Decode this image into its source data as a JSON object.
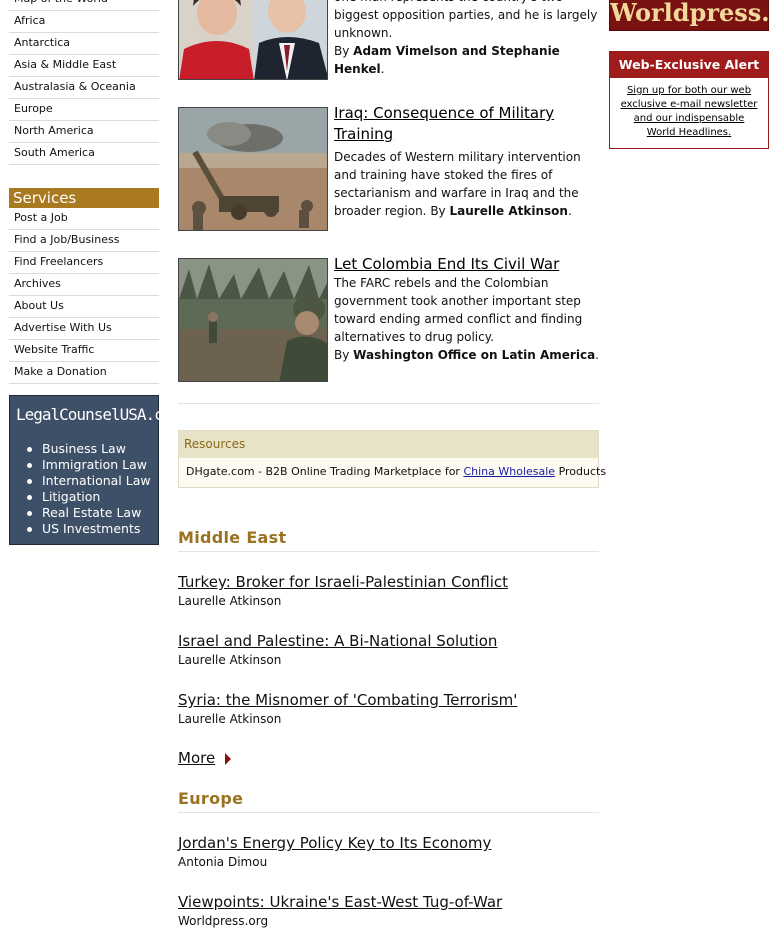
{
  "nav": {
    "regions": [
      "Map of the World",
      "Africa",
      "Antarctica",
      "Asia & Middle East",
      "Australasia & Oceania",
      "Europe",
      "North America",
      "South America"
    ]
  },
  "services": {
    "title": "Services",
    "items": [
      "Post a Job",
      "Find a Job/Business",
      "Find Freelancers",
      "Archives",
      "About Us",
      "Advertise With Us",
      "Website Traffic",
      "Make a Donation"
    ]
  },
  "legal_ad": {
    "logo": "LegalCounselUSA.com",
    "items": [
      "Business Law",
      "Immigration Law",
      "International Law",
      "Litigation",
      "Real Estate Law",
      "US Investments"
    ]
  },
  "stories": [
    {
      "title": "",
      "summary": "in Turkey's upcoming presidential election, one man represents the country's two biggest opposition parties, and he is largely unknown.",
      "by_prefix": "By ",
      "author": "Adam Vimelson and Stephanie Henkel",
      "by_suffix": "."
    },
    {
      "title": "Iraq: Consequence of Military Training",
      "summary": "Decades of Western military intervention and training have stoked the fires of sectarianism and warfare in Iraq and the broader region.",
      "by_prefix": "By ",
      "author": "Laurelle Atkinson",
      "by_suffix": "."
    },
    {
      "title": "Let Colombia End Its Civil War",
      "summary": "The FARC rebels and the Colombian government took another important step toward ending armed conflict and finding alternatives to drug policy.",
      "by_prefix": "By ",
      "author": "Washington Office on Latin America",
      "by_suffix": "."
    }
  ],
  "resources": {
    "title": "Resources",
    "text_before": "DHgate.com - B2B Online Trading Marketplace for ",
    "link": "China Wholesale",
    "text_after": " Products"
  },
  "sections": [
    {
      "title": "Middle East",
      "items": [
        {
          "title": "Turkey: Broker for Israeli-Palestinian Conflict",
          "author": "Laurelle Atkinson"
        },
        {
          "title": "Israel and Palestine: A Bi-National Solution",
          "author": "Laurelle Atkinson"
        },
        {
          "title": "Syria: the Misnomer of 'Combating Terrorism'",
          "author": "Laurelle Atkinson"
        }
      ],
      "more": "More"
    },
    {
      "title": "Europe",
      "items": [
        {
          "title": "Jordan's Energy Policy Key to Its Economy",
          "author": "Antonia Dimou"
        },
        {
          "title": "Viewpoints: Ukraine's East-West Tug-of-War",
          "author": "Worldpress.org"
        }
      ]
    }
  ],
  "right": {
    "logo": "Worldpress.org",
    "alert_title": "Web-Exclusive Alert",
    "alert_text": "Sign up for both our web exclusive e-mail newsletter and our indispensable World Headlines."
  },
  "colors": {
    "services_header": "#a97a1f",
    "section_title": "#9a7320",
    "alert_red": "#a01b1b",
    "ad_blue": "#3d5068"
  }
}
